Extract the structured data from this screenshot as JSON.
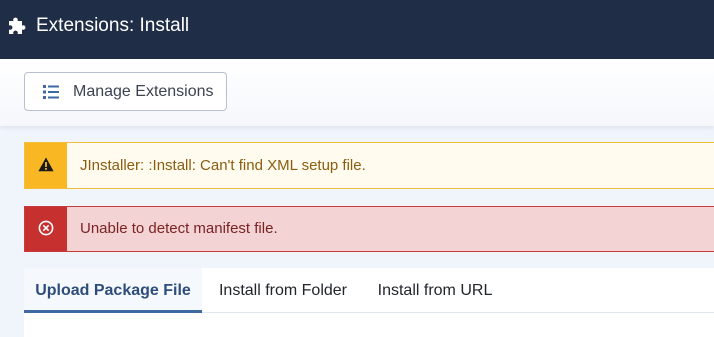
{
  "header": {
    "title": "Extensions: Install",
    "icon": "puzzle-icon"
  },
  "toolbar": {
    "manage_label": "Manage Extensions",
    "manage_icon": "list-icon"
  },
  "alerts": [
    {
      "type": "warning",
      "icon": "warning-triangle-icon",
      "message": "JInstaller: :Install: Can't find XML setup file."
    },
    {
      "type": "danger",
      "icon": "error-circle-icon",
      "message": "Unable to detect manifest file."
    }
  ],
  "tabs": [
    {
      "label": "Upload Package File",
      "active": true
    },
    {
      "label": "Install from Folder",
      "active": false
    },
    {
      "label": "Install from URL",
      "active": false
    }
  ],
  "colors": {
    "header_bg": "#1f2d46",
    "warning": "#f9b724",
    "danger": "#c6302f",
    "active_tab": "#3f6aa1"
  }
}
